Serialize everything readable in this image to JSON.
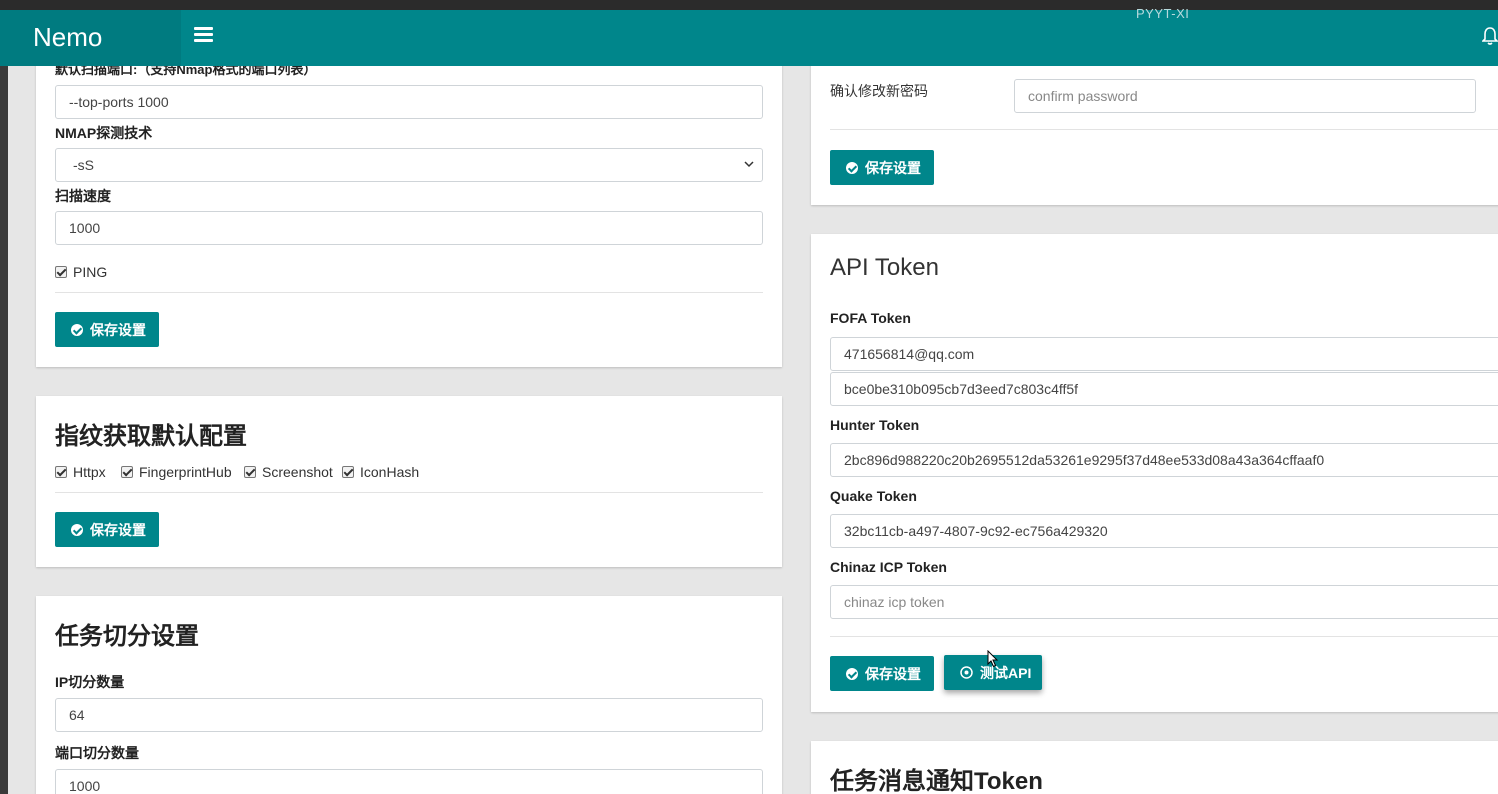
{
  "navbar": {
    "brand": "Nemo",
    "watermark": "PYYT-XI"
  },
  "nmap_card": {
    "port_label": "默认扫描端口:（支持Nmap格式的端口列表）",
    "port_value": "--top-ports 1000",
    "tech_label": "NMAP探测技术",
    "tech_value": "-sS",
    "speed_label": "扫描速度",
    "speed_value": "1000",
    "ping_label": "PING",
    "save_label": "保存设置"
  },
  "fingerprint_card": {
    "title": "指纹获取默认配置",
    "options": [
      "Httpx",
      "FingerprintHub",
      "Screenshot",
      "IconHash"
    ],
    "save_label": "保存设置"
  },
  "task_split_card": {
    "title": "任务切分设置",
    "ip_label": "IP切分数量",
    "ip_value": "64",
    "port_label": "端口切分数量",
    "port_value": "1000"
  },
  "password_card": {
    "confirm_label": "确认修改新密码",
    "confirm_placeholder": "confirm password",
    "save_label": "保存设置"
  },
  "api_card": {
    "title": "API Token",
    "fofa_label": "FOFA Token",
    "fofa_email": "471656814@qq.com",
    "fofa_key": "bce0be310b095cb7d3eed7c803c4ff5f",
    "hunter_label": "Hunter Token",
    "hunter_value": "2bc896d988220c20b2695512da53261e9295f37d48ee533d08a43a364cffaaf0",
    "quake_label": "Quake Token",
    "quake_value": "32bc11cb-a497-4807-9c92-ec756a429320",
    "chinaz_label": "Chinaz ICP Token",
    "chinaz_placeholder": "chinaz icp token",
    "save_label": "保存设置",
    "test_label": "测试API"
  },
  "notify_card": {
    "title": "任务消息通知Token"
  },
  "colors": {
    "primary": "#00868b",
    "brand_bg": "#007b80",
    "page_bg": "#e6e6e6"
  }
}
